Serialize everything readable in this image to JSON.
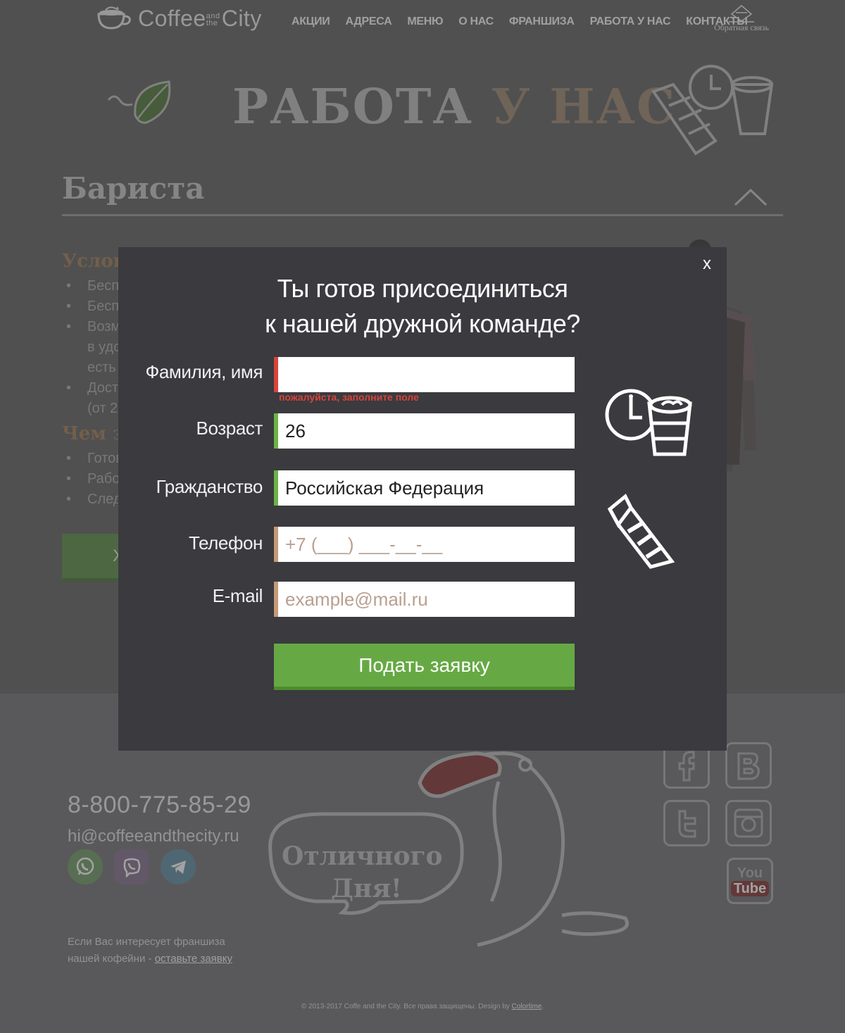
{
  "header": {
    "logo": {
      "word1": "Coffee",
      "word2": "and the",
      "word3": "City"
    },
    "nav": [
      "АКЦИИ",
      "АДРЕСА",
      "МЕНЮ",
      "О НАС",
      "ФРАНШИЗА",
      "РАБОТА У НАС",
      "КОНТАКТЫ"
    ],
    "feedback_label": "Обратная связь"
  },
  "hero": {
    "title_part1": "РАБОТА",
    "title_part2": "У НАС"
  },
  "vacancy": {
    "title": "Бариста",
    "conditions_heading": "Услов",
    "conditions_items": [
      "Беспл",
      "Беспл",
      "Возм",
      "в удо",
      "есть д",
      "Досто",
      "(от 25"
    ],
    "duties_heading": "Чем з",
    "duties_items": [
      "Готов",
      "Работ",
      "Следи"
    ],
    "button_label": "Х"
  },
  "modal": {
    "close_label": "x",
    "title_line1": "Ты готов присоединиться",
    "title_line2": "к нашей дружной команде?",
    "fields": {
      "name": {
        "label": "Фамилия, имя",
        "value": "",
        "error": "пожалуйста, заполните поле"
      },
      "age": {
        "label": "Возраст",
        "value": "26"
      },
      "citizenship": {
        "label": "Гражданство",
        "value": "Российская Федерация"
      },
      "phone": {
        "label": "Телефон",
        "value": "",
        "placeholder": "+7 (___) ___-__-__"
      },
      "email": {
        "label": "E-mail",
        "value": "",
        "placeholder": "example@mail.ru"
      }
    },
    "submit_label": "Подать заявку"
  },
  "footer": {
    "phone": "8-800-775-85-29",
    "email": "hi@coffeeandthecity.ru",
    "franchise_text": "Если Вас интересует франшиза нашей кофейни - ",
    "franchise_link": "оставьте заявку",
    "toucan_bubble_line1": "Отличного",
    "toucan_bubble_line2": "Дня!",
    "copyright_text": "© 2013-2017 Coffe and the City. Все права защищены. Design by ",
    "copyright_link": "Colortime",
    "copyright_end": ".",
    "youtube_label_top": "You",
    "youtube_label_bottom": "Tube"
  },
  "colors": {
    "accent_green": "#66a944",
    "error_red": "#d8443a",
    "modal_bg": "#3a3a3f",
    "hero_brown": "#9d8a7a"
  }
}
